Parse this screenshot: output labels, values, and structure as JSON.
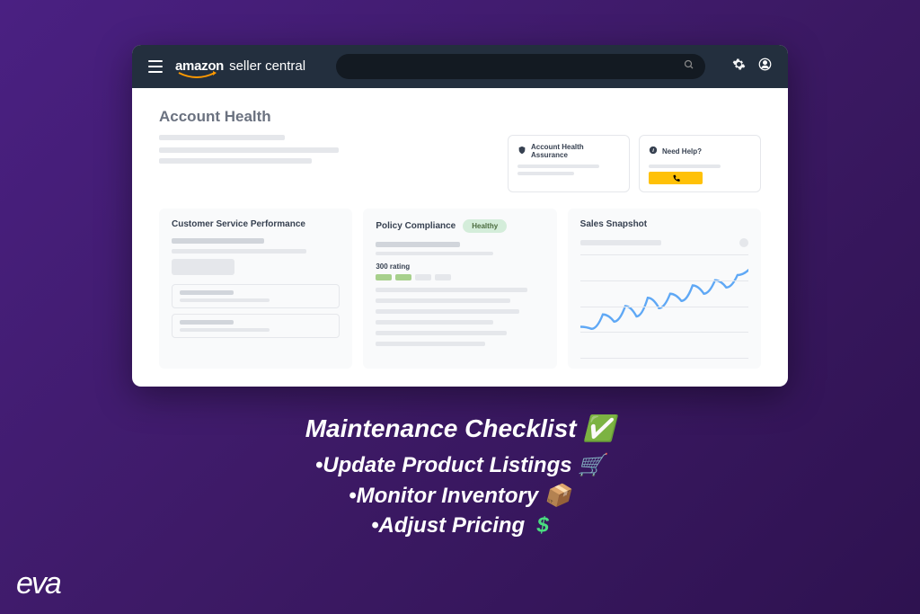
{
  "header": {
    "brand_amazon": "amazon",
    "brand_seller": "seller central",
    "search_placeholder": ""
  },
  "page": {
    "title": "Account Health"
  },
  "info_cards": {
    "assurance": {
      "title": "Account Health Assurance"
    },
    "help": {
      "title": "Need Help?"
    }
  },
  "metrics": {
    "customer_service": {
      "title": "Customer Service Performance"
    },
    "policy": {
      "title": "Policy Compliance",
      "badge": "Healthy",
      "rating": "300 rating"
    },
    "sales": {
      "title": "Sales Snapshot"
    }
  },
  "checklist": {
    "title": "Maintenance Checklist",
    "items": [
      "Update Product Listings",
      "Monitor Inventory",
      "Adjust Pricing"
    ]
  },
  "footer": {
    "brand": "eva"
  },
  "chart_data": {
    "type": "line",
    "x": [
      0,
      1,
      2,
      3,
      4,
      5,
      6,
      7,
      8,
      9,
      10,
      11,
      12,
      13,
      14,
      15
    ],
    "values": [
      30,
      28,
      42,
      35,
      50,
      40,
      58,
      48,
      62,
      55,
      70,
      62,
      75,
      68,
      80,
      85
    ],
    "ylim": [
      0,
      100
    ],
    "title": "",
    "xlabel": "",
    "ylabel": ""
  }
}
